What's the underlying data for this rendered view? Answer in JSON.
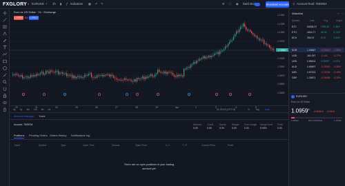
{
  "topbar": {
    "logo": "FXGLORY",
    "symbol": "EURUSD",
    "interval": "1h",
    "indicators": "Indicators",
    "theme_label": "Dark Mode",
    "account_type_button": "Standard Account",
    "account_label": "Account Real: 7500004"
  },
  "chart": {
    "title": "Euro vs US Dollar · 1h · Exchange",
    "sell_price": "1.09587",
    "buy_price": "1.09617",
    "spread": "3.0",
    "price_ticks": [
      "1.1050",
      "1.1025",
      "1.1000",
      "1.0975",
      "1.0950",
      "1.0925",
      "1.0900",
      "1.0875",
      "1.0850",
      "1.0825"
    ],
    "last_price_tag": "1.09587",
    "date_ticks": [
      "20",
      "21",
      "22",
      "25",
      "26",
      "27",
      "28",
      "29",
      "Apr",
      "2",
      "3",
      "4",
      "5"
    ],
    "timeframes": [
      "5y",
      "1y",
      "3m",
      "1m",
      "5d",
      "1d"
    ],
    "clock": "01:23:13 (UTC+3)",
    "bottom_right": [
      "%",
      "log",
      "auto"
    ],
    "colors": {
      "up": "#26a69a",
      "down": "#ef5350",
      "bg": "#131722",
      "last_price": "#26a69a"
    }
  },
  "bottom_panel": {
    "tab_active": "Account Manager",
    "tab_trade": "Trade",
    "account_label": "Account: 7500004",
    "stats_headers": [
      "Balance",
      "Credit",
      "Equity",
      "Margin",
      "Free margin",
      "Margin level",
      "Profit"
    ],
    "stats_values": [
      "0.00",
      "0.00",
      "0.00",
      "0.00",
      "0.00",
      "0.00%",
      "0.00"
    ],
    "subtabs": [
      "Positions",
      "Pending Orders",
      "Orders History",
      "Notifications log"
    ],
    "columns": [
      "Ticket",
      "Symbol",
      "Type",
      "Open Time",
      "Volume",
      "Open Price",
      "S / L",
      "T / P",
      "Current Price",
      "Profit"
    ],
    "empty_message_1": "There are no open positions in your trading",
    "empty_message_2": "account yet"
  },
  "watchlist": {
    "title": "Watchlist",
    "headers": [
      "Symbol",
      "Last",
      "Chg",
      "Chg%"
    ],
    "group1": [
      {
        "sym": "BTC",
        "last": "84536.37",
        "chg": "1955.49",
        "pct": "2.36%",
        "dir": "up"
      },
      {
        "sym": "ETH",
        "last": "1816.77",
        "chg": "65.20",
        "pct": "3.72%",
        "dir": "up"
      },
      {
        "sym": "BCH",
        "last": "296.37",
        "chg": "8.19",
        "pct": "2.84%",
        "dir": "up"
      }
    ],
    "group2": [
      {
        "sym": "EUR",
        "last": "1.09587",
        "chg": "-0.00619",
        "pct": "-0.56%",
        "dir": "down",
        "active": true
      },
      {
        "sym": "USD",
        "last": "161.097",
        "chg": "-0.441",
        "pct": "-0.27%",
        "dir": "down"
      },
      {
        "sym": "USD",
        "last": "0.88104",
        "chg": "0.00097",
        "pct": "0.11%",
        "dir": "up"
      },
      {
        "sym": "AUD",
        "last": "0.65597",
        "chg": "-0.00319",
        "pct": "-0.48%",
        "dir": "down"
      },
      {
        "sym": "NZD",
        "last": "0.57223",
        "chg": "-0.00246",
        "pct": "-0.43%",
        "dir": "down"
      },
      {
        "sym": "GBP",
        "last": "1.29571",
        "chg": "-0.00430",
        "pct": "-0.33%",
        "dir": "down"
      }
    ],
    "details": {
      "symbol": "EURUSD",
      "name": "Euro vs US Dollar",
      "price": "1.0959",
      "price_sup": "1",
      "change": "-0.00619",
      "change_pct": "-0.56%",
      "low": "1.09522",
      "high": "1.10512",
      "day_range_label": "DAY'S RANGE"
    }
  }
}
